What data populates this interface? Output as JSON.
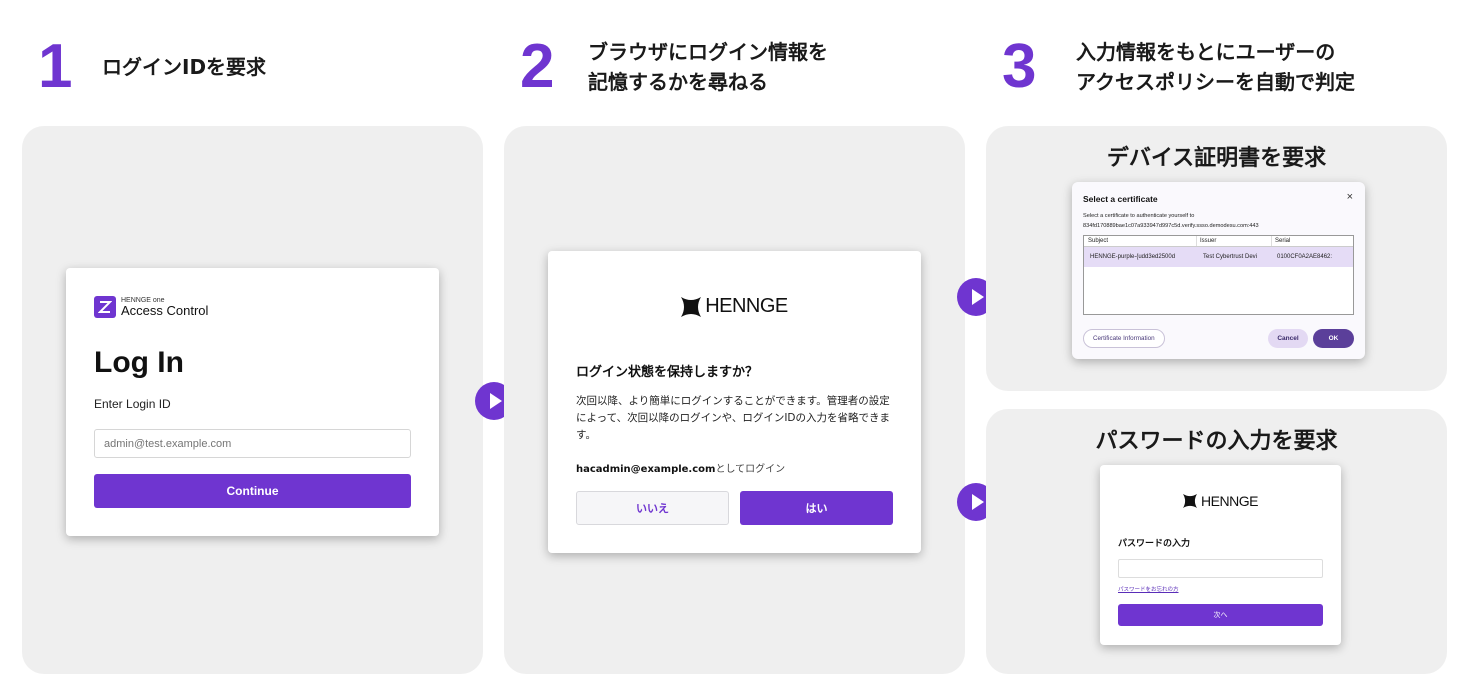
{
  "colors": {
    "accent": "#6f35d0",
    "panel_bg": "#efefef"
  },
  "steps": [
    {
      "num": "1",
      "title": "ログインIDを要求"
    },
    {
      "num": "2",
      "title": "ブラウザにログイン情報を\n記憶するかを尋ねる"
    },
    {
      "num": "3",
      "title": "入力情報をもとにユーザーの\nアクセスポリシーを自動で判定"
    }
  ],
  "login": {
    "brand_small": "HENNGE one",
    "brand_name": "Access Control",
    "heading": "Log In",
    "subheading": "Enter Login ID",
    "input_placeholder": "admin@test.example.com",
    "continue_label": "Continue"
  },
  "remember": {
    "logo": "HENNGE",
    "question": "ログイン状態を保持しますか？",
    "description": "次回以降、より簡単にログインすることができます。管理者の設定によって、次回以降のログインや、ログインIDの入力を省略できます。",
    "account_email": "hacadmin@example.com",
    "account_suffix": "としてログイン",
    "no_label": "いいえ",
    "yes_label": "はい"
  },
  "certificate": {
    "panel_title": "デバイス証明書を要求",
    "dialog_title": "Select a certificate",
    "close_glyph": "×",
    "desc_line1": "Select a certificate to authenticate yourself to",
    "desc_line2": "834fd170889bae1c07a933947d997c5d.verify.ssso.demodesu.com:443",
    "columns": [
      "Subject",
      "Issuer",
      "Serial"
    ],
    "row": [
      "HENNGE-purple-{udd3ed2500d",
      "Test Cybertrust Devi",
      "0100CF0A2AE8462:"
    ],
    "info_label": "Certificate Information",
    "cancel_label": "Cancel",
    "ok_label": "OK"
  },
  "password": {
    "panel_title": "パスワードの入力を要求",
    "logo": "HENNGE",
    "label": "パスワードの入力",
    "forgot_link": "パスワードをお忘れの方",
    "next_label": "次へ"
  }
}
